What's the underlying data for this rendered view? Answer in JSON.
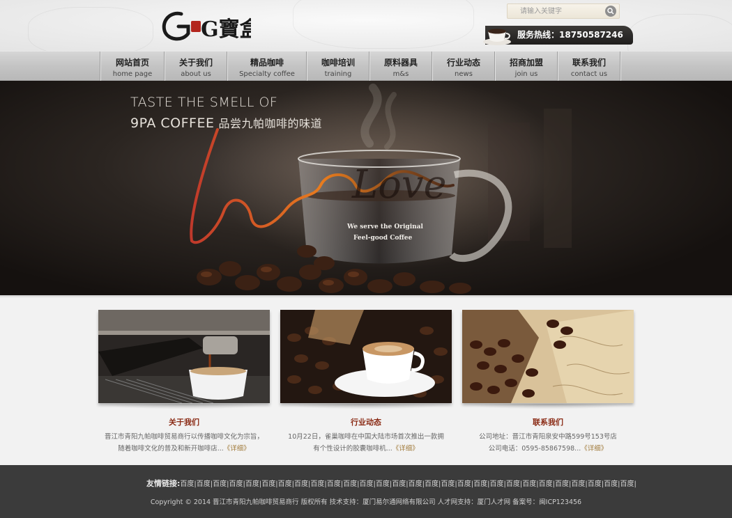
{
  "brand": {
    "logo_text": "G寶盒"
  },
  "search": {
    "placeholder": "请输入关键字"
  },
  "hotline": {
    "label": "服务热线：18750587246"
  },
  "nav": [
    {
      "zh": "网站首页",
      "en": "home page"
    },
    {
      "zh": "关于我们",
      "en": "about us"
    },
    {
      "zh": "精品咖啡",
      "en": "Specialty coffee"
    },
    {
      "zh": "咖啡培训",
      "en": "training"
    },
    {
      "zh": "原料器具",
      "en": "m&s"
    },
    {
      "zh": "行业动态",
      "en": "news"
    },
    {
      "zh": "招商加盟",
      "en": "join us"
    },
    {
      "zh": "联系我们",
      "en": "contact us"
    }
  ],
  "banner": {
    "line1": "TASTE THE SMELL OF",
    "line2": "9PA COFFEE",
    "line2_zh": "品尝九帕咖啡的味道",
    "script_word": "Love",
    "cup_line1": "We serve the Original",
    "cup_line2": "Feel-good Coffee"
  },
  "cards": [
    {
      "title": "关于我们",
      "line1": "晋江市青阳九帕咖啡贸易商行以传播咖啡文化为宗旨，",
      "line2": "随着咖啡文化的普及和新开咖啡店...",
      "more": "《详细》"
    },
    {
      "title": "行业动态",
      "line1": "10月22日，雀巢咖啡在中国大陆市场首次推出一款拥",
      "line2": "有个性设计的胶囊咖啡机...",
      "more": "《详细》"
    },
    {
      "title": "联系我们",
      "line1": "公司地址：晋江市青阳泉安中路599号153号店",
      "line2": "公司电话：0595-85867598...",
      "more": "《详细》"
    }
  ],
  "footer": {
    "links_label": "友情链接:",
    "links": [
      "百度",
      "百度",
      "百度",
      "百度",
      "百度",
      "百度",
      "百度",
      "百度",
      "百度",
      "百度",
      "百度",
      "百度",
      "百度",
      "百度",
      "百度",
      "百度",
      "百度",
      "百度",
      "百度",
      "百度",
      "百度",
      "百度",
      "百度",
      "百度",
      "百度",
      "百度",
      "百度",
      "百度"
    ],
    "copyright": "Copyright © 2014 晋江市青阳九帕咖啡贸易商行 版权所有 技术支持：厦门易尔通网络有限公司 人才网支持：厦门人才网 备案号：闽ICP123456"
  },
  "colors": {
    "nav_bg": "#c8c8c8",
    "banner_bg": "#2b2521",
    "card_title": "#8a2a14",
    "more_link": "#a07a3a",
    "footer_bg": "#3b3b3b"
  }
}
